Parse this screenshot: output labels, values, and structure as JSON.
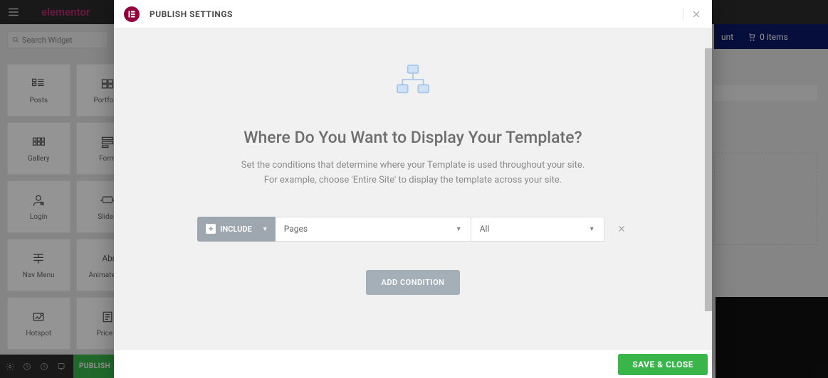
{
  "bg": {
    "top_title": "elementor",
    "search_placeholder": "Search Widget",
    "account_label": "unt",
    "cart_label": "0 items",
    "publish_btn": "PUBLISH",
    "widgets": [
      {
        "label": "Posts"
      },
      {
        "label": "Portfolio"
      },
      {
        "label": "Gallery"
      },
      {
        "label": "Form"
      },
      {
        "label": "Login"
      },
      {
        "label": "Slides"
      },
      {
        "label": "Nav Menu"
      },
      {
        "label": "Animated H"
      },
      {
        "label": "Hotspot"
      },
      {
        "label": "Price L"
      }
    ]
  },
  "modal": {
    "title": "PUBLISH SETTINGS",
    "heading": "Where Do You Want to Display Your Template?",
    "description_line1": "Set the conditions that determine where your Template is used throughout your site.",
    "description_line2": "For example, choose 'Entire Site' to display the template across your site.",
    "condition": {
      "include_label": "INCLUDE",
      "select1": "Pages",
      "select2": "All"
    },
    "add_condition_label": "ADD CONDITION",
    "save_label": "SAVE & CLOSE"
  }
}
